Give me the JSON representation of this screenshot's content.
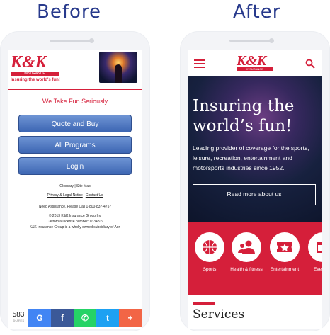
{
  "headings": {
    "before": "Before",
    "after": "After"
  },
  "before": {
    "logo": "K&K",
    "logo_strip": "INSURANCE",
    "logo_tagline": "Insuring the world's fun!",
    "tagline": "We Take Fun Seriously",
    "buttons": [
      "Quote and Buy",
      "All Programs",
      "Login"
    ],
    "links": {
      "glossary": "Glossary",
      "sep1": " | ",
      "sitemap": "Site Map",
      "privacy": "Privacy & Legal Notice",
      "sep2": " | ",
      "contact": "Contact Us"
    },
    "assistance": "Need Assistance, Please Call 1-800-837-4757",
    "copyright": "© 2013 K&K Insurance Group Inc",
    "license": "California License number: 0334819",
    "owned": "K&K Insurance Group is a wholly owned subsidiary of Aon",
    "share": {
      "count": "583",
      "label": "SHARES",
      "buttons": [
        {
          "glyph": "G",
          "color": "#4285f4"
        },
        {
          "glyph": "f",
          "color": "#3b5998"
        },
        {
          "glyph": "✆",
          "color": "#25d366"
        },
        {
          "glyph": "t",
          "color": "#1da1f2"
        },
        {
          "glyph": "+",
          "color": "#f26546"
        }
      ]
    }
  },
  "after": {
    "logo": "K&K",
    "logo_strip": "INSURANCE",
    "hero_title": "Insuring the world’s fun!",
    "hero_desc": "Leading provider of coverage for the sports, leisure, recreation, entertainment and motorsports industries since 1952.",
    "read_more": "Read more about us",
    "categories": [
      {
        "label": "Sports",
        "icon": "basketball-icon"
      },
      {
        "label": "Health & fitness",
        "icon": "people-icon"
      },
      {
        "label": "Entertainment",
        "icon": "ticket-icon"
      },
      {
        "label": "Eve attra",
        "icon": "calendar-icon"
      }
    ],
    "services": "Services"
  },
  "colors": {
    "brand_red": "#d51f3a",
    "button_blue": "#3d66b3",
    "heading_blue": "#283a8c",
    "hero_dark": "#17213f"
  }
}
